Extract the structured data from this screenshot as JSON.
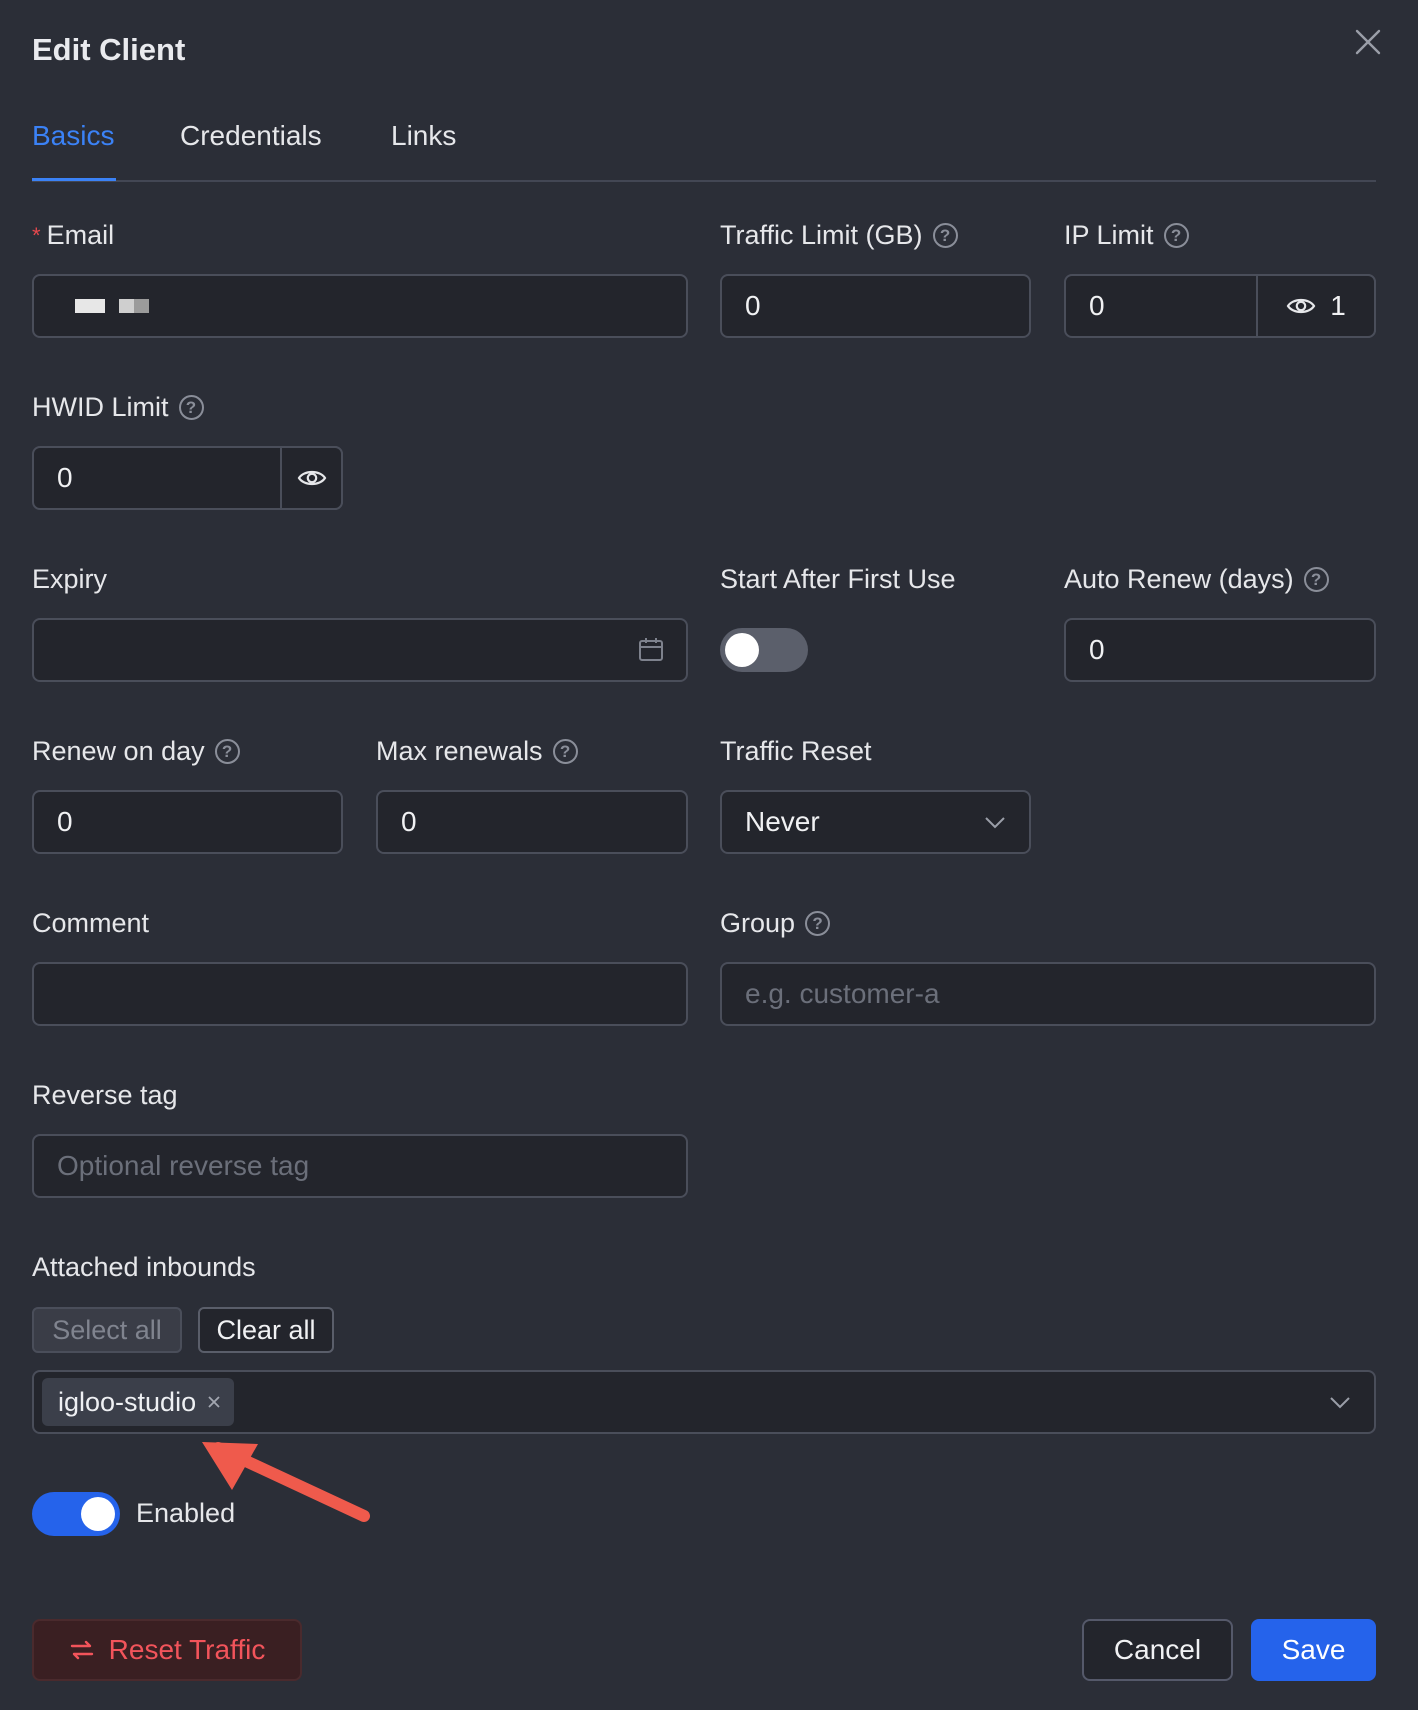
{
  "dialog": {
    "title": "Edit Client"
  },
  "tabs": [
    {
      "label": "Basics",
      "active": true
    },
    {
      "label": "Credentials",
      "active": false
    },
    {
      "label": "Links",
      "active": false
    }
  ],
  "fields": {
    "email": {
      "label": "Email",
      "required_mark": "*"
    },
    "traffic_limit": {
      "label": "Traffic Limit (GB)",
      "value": "0"
    },
    "ip_limit": {
      "label": "IP Limit",
      "value": "0",
      "addon_count": "1"
    },
    "hwid_limit": {
      "label": "HWID Limit",
      "value": "0"
    },
    "expiry": {
      "label": "Expiry",
      "value": ""
    },
    "start_after_first_use": {
      "label": "Start After First Use",
      "enabled": false
    },
    "auto_renew": {
      "label": "Auto Renew (days)",
      "value": "0"
    },
    "renew_on_day": {
      "label": "Renew on day",
      "value": "0"
    },
    "max_renewals": {
      "label": "Max renewals",
      "value": "0"
    },
    "traffic_reset": {
      "label": "Traffic Reset",
      "value": "Never"
    },
    "comment": {
      "label": "Comment",
      "value": ""
    },
    "group": {
      "label": "Group",
      "placeholder": "e.g. customer-a"
    },
    "reverse_tag": {
      "label": "Reverse tag",
      "placeholder": "Optional reverse tag"
    }
  },
  "inbounds": {
    "label": "Attached inbounds",
    "select_all": "Select all",
    "clear_all": "Clear all",
    "tags": [
      "igloo-studio"
    ]
  },
  "enabled": {
    "label": "Enabled",
    "value": true
  },
  "footer": {
    "reset_traffic": "Reset Traffic",
    "cancel": "Cancel",
    "save": "Save"
  },
  "colors": {
    "accent": "#2563eb",
    "danger": "#f2545b",
    "annotation_arrow": "#ef5a4c"
  },
  "icons": [
    "close-icon",
    "help-icon",
    "eye-icon",
    "calendar-icon",
    "chevron-down-icon",
    "tag-remove-icon",
    "reset-icon",
    "annotation-arrow"
  ]
}
